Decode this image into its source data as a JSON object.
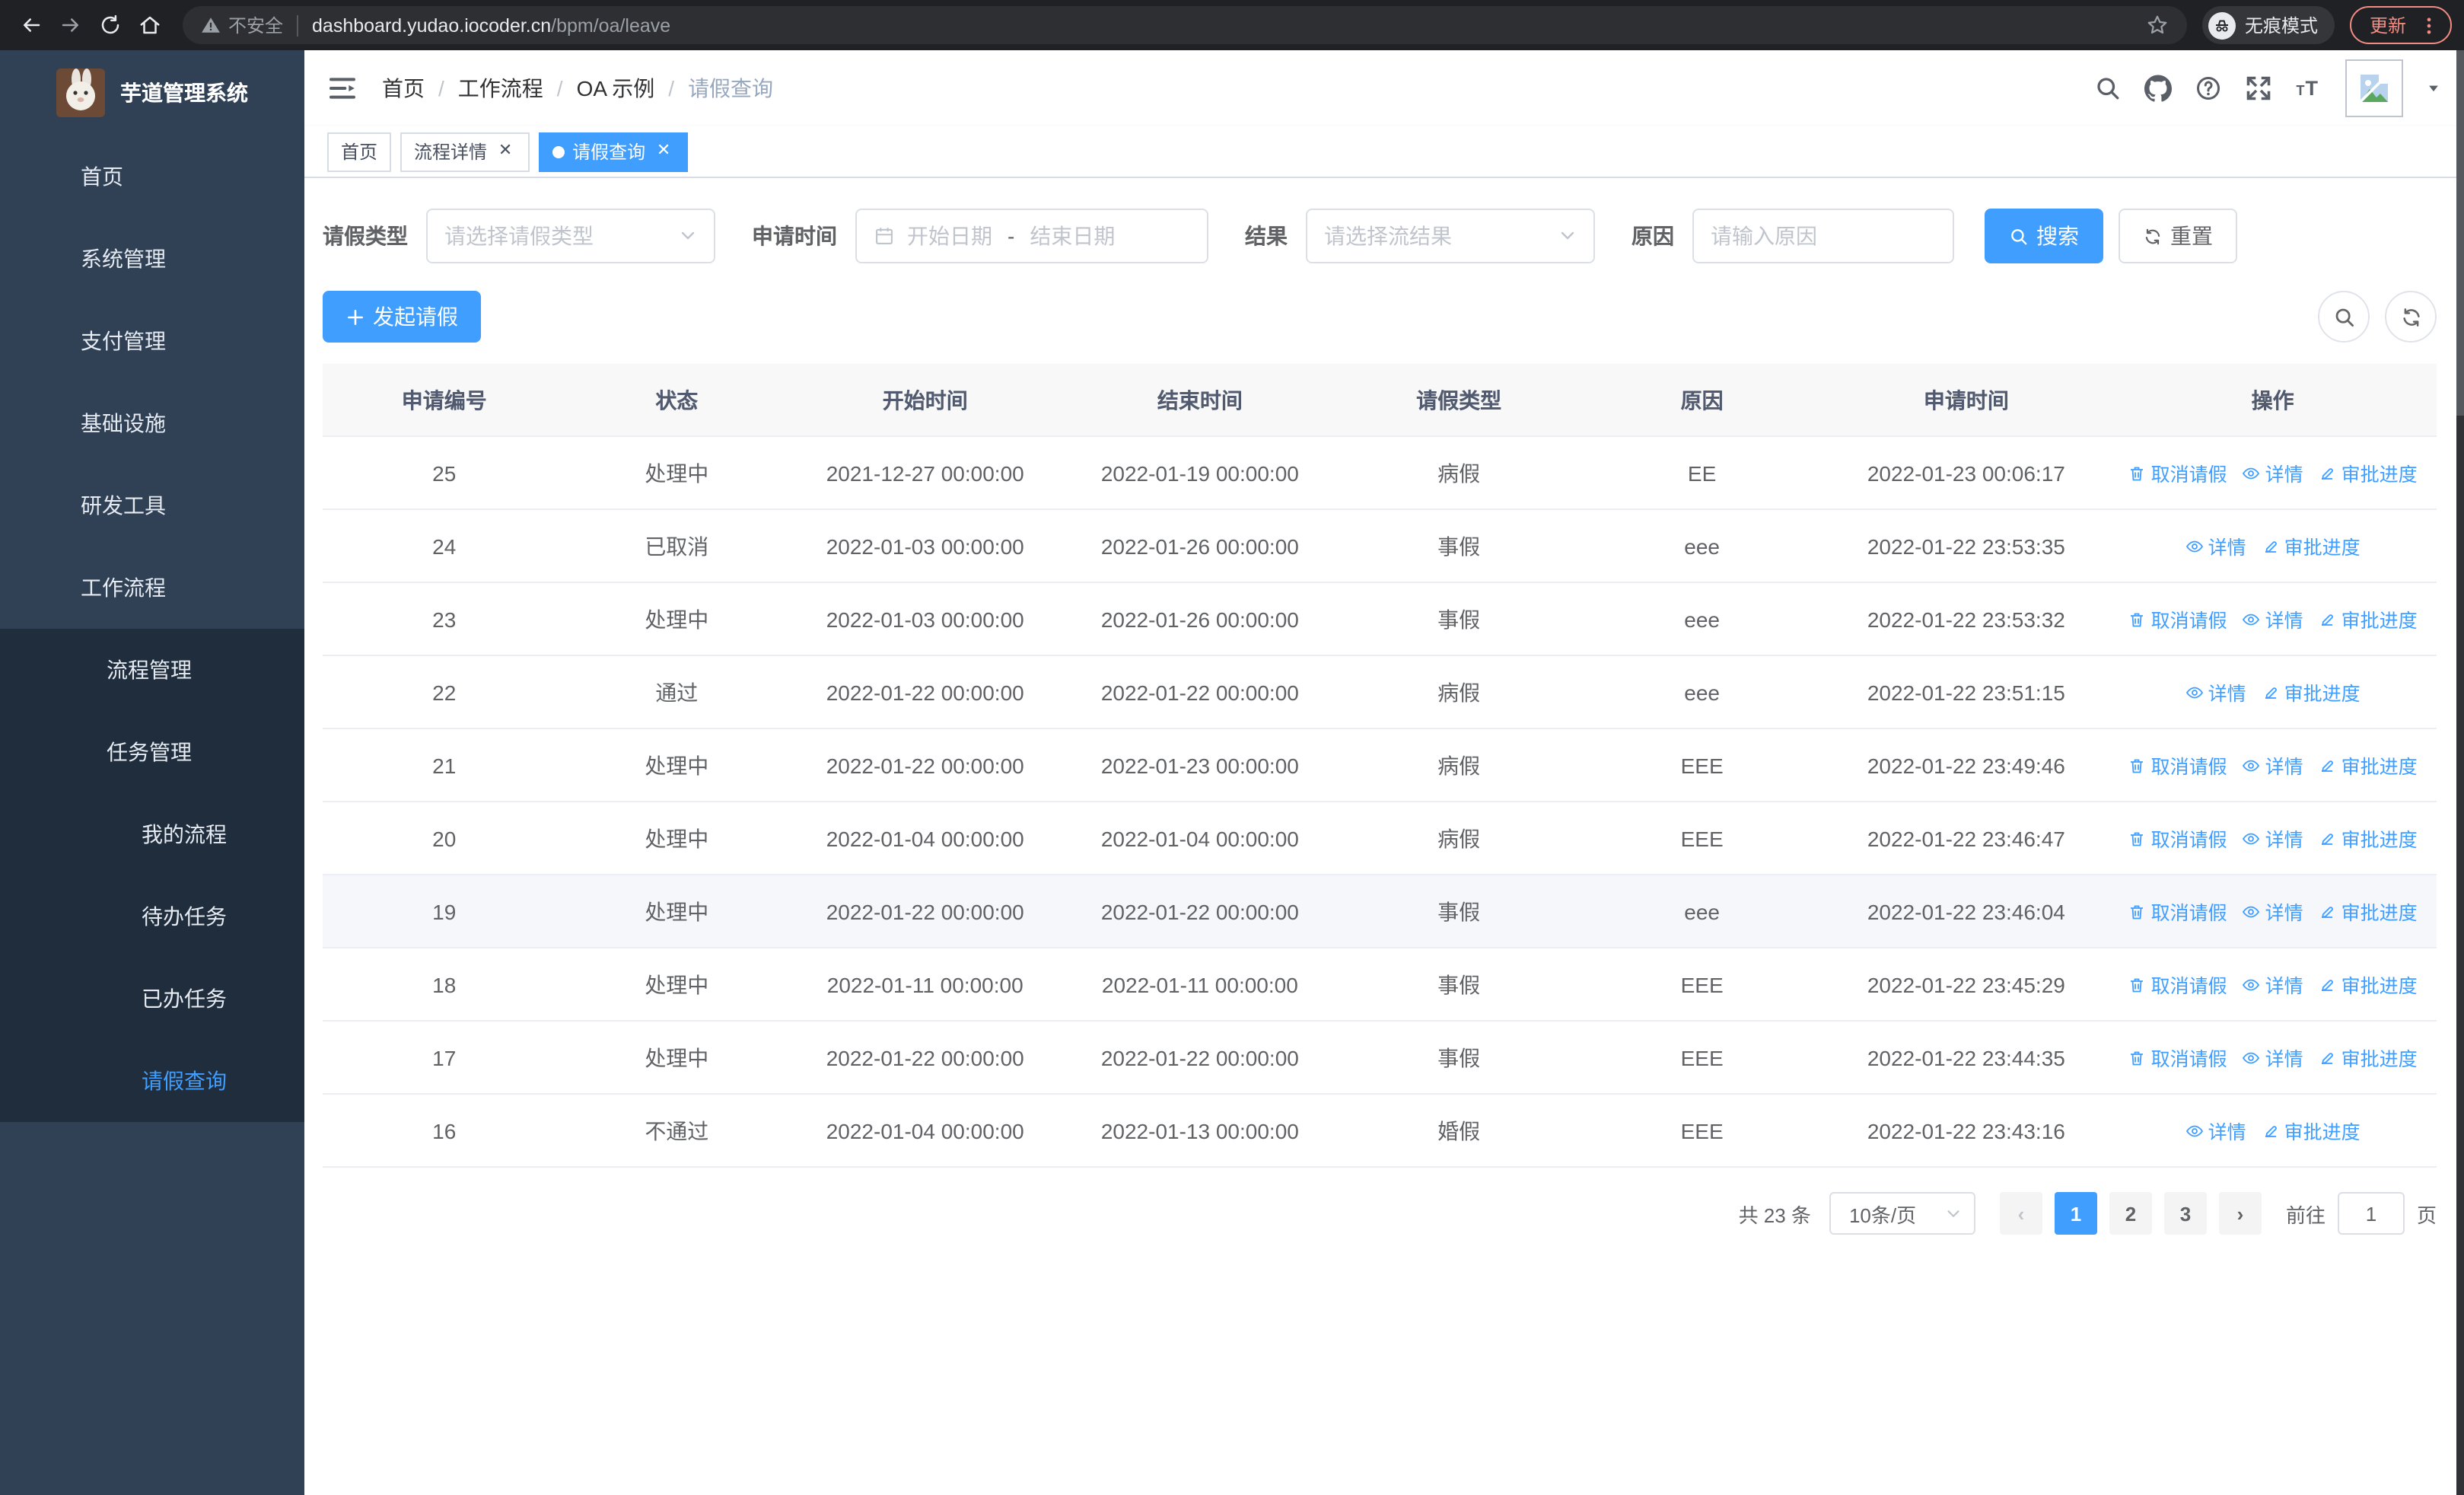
{
  "colors": {
    "accent": "#409EFF",
    "sidebar_bg": "#304156",
    "submenu_bg": "#1f2d3d",
    "update_chip": "#f28b82"
  },
  "browser": {
    "security_label": "不安全",
    "url_host": "dashboard.yudao.iocoder.cn",
    "url_path": "/bpm/oa/leave",
    "incognito_label": "无痕模式",
    "update_label": "更新"
  },
  "sidebar": {
    "logo_title": "芋道管理系统",
    "items": [
      {
        "label": "首页",
        "icon": "dashboard-icon",
        "depth": 1,
        "chevron": "",
        "submenu": false,
        "active": false
      },
      {
        "label": "系统管理",
        "icon": "gear-icon",
        "depth": 1,
        "chevron": "down",
        "submenu": false,
        "active": false
      },
      {
        "label": "支付管理",
        "icon": "yen-icon",
        "depth": 1,
        "chevron": "down",
        "submenu": false,
        "active": false
      },
      {
        "label": "基础设施",
        "icon": "monitor-icon",
        "depth": 1,
        "chevron": "down",
        "submenu": false,
        "active": false
      },
      {
        "label": "研发工具",
        "icon": "toolbox-icon",
        "depth": 1,
        "chevron": "down",
        "submenu": false,
        "active": false
      },
      {
        "label": "工作流程",
        "icon": "briefcase-icon",
        "depth": 1,
        "chevron": "up",
        "submenu": false,
        "active": false
      },
      {
        "label": "流程管理",
        "icon": "list-icon",
        "depth": 2,
        "chevron": "down",
        "submenu": true,
        "active": false
      },
      {
        "label": "任务管理",
        "icon": "flow-icon",
        "depth": 2,
        "chevron": "up",
        "submenu": true,
        "active": false
      },
      {
        "label": "我的流程",
        "icon": "robot-icon",
        "depth": 3,
        "chevron": "",
        "submenu": true,
        "active": false
      },
      {
        "label": "待办任务",
        "icon": "eye-icon",
        "depth": 3,
        "chevron": "",
        "submenu": true,
        "active": false
      },
      {
        "label": "已办任务",
        "icon": "eye-closed-icon",
        "depth": 3,
        "chevron": "",
        "submenu": true,
        "active": false
      },
      {
        "label": "请假查询",
        "icon": "user-icon",
        "depth": 3,
        "chevron": "",
        "submenu": true,
        "active": true
      }
    ]
  },
  "header": {
    "breadcrumb": [
      {
        "label": "首页",
        "current": false
      },
      {
        "label": "工作流程",
        "current": false
      },
      {
        "label": "OA 示例",
        "current": false
      },
      {
        "label": "请假查询",
        "current": true
      }
    ]
  },
  "tags": [
    {
      "label": "首页",
      "closable": false,
      "active": false
    },
    {
      "label": "流程详情",
      "closable": true,
      "active": false
    },
    {
      "label": "请假查询",
      "closable": true,
      "active": true
    }
  ],
  "filters": {
    "leave_type_label": "请假类型",
    "leave_type_placeholder": "请选择请假类型",
    "apply_time_label": "申请时间",
    "start_placeholder": "开始日期",
    "range_separator": "-",
    "end_placeholder": "结束日期",
    "result_label": "结果",
    "result_placeholder": "请选择流结果",
    "reason_label": "原因",
    "reason_placeholder": "请输入原因",
    "search_label": "搜索",
    "reset_label": "重置"
  },
  "toolbar": {
    "create_label": "发起请假"
  },
  "actions": {
    "cancel": {
      "label": "取消请假",
      "icon": "trash-icon"
    },
    "detail": {
      "label": "详情",
      "icon": "view-icon"
    },
    "progress": {
      "label": "审批进度",
      "icon": "edit-icon"
    }
  },
  "table": {
    "columns": [
      "申请编号",
      "状态",
      "开始时间",
      "结束时间",
      "请假类型",
      "原因",
      "申请时间",
      "操作"
    ],
    "rows": [
      {
        "id": "25",
        "status": "处理中",
        "start": "2021-12-27 00:00:00",
        "end": "2022-01-19 00:00:00",
        "type": "病假",
        "reason": "EE",
        "applied": "2022-01-23 00:06:17",
        "actions": [
          "cancel",
          "detail",
          "progress"
        ],
        "hover": false
      },
      {
        "id": "24",
        "status": "已取消",
        "start": "2022-01-03 00:00:00",
        "end": "2022-01-26 00:00:00",
        "type": "事假",
        "reason": "eee",
        "applied": "2022-01-22 23:53:35",
        "actions": [
          "detail",
          "progress"
        ],
        "hover": false
      },
      {
        "id": "23",
        "status": "处理中",
        "start": "2022-01-03 00:00:00",
        "end": "2022-01-26 00:00:00",
        "type": "事假",
        "reason": "eee",
        "applied": "2022-01-22 23:53:32",
        "actions": [
          "cancel",
          "detail",
          "progress"
        ],
        "hover": false
      },
      {
        "id": "22",
        "status": "通过",
        "start": "2022-01-22 00:00:00",
        "end": "2022-01-22 00:00:00",
        "type": "病假",
        "reason": "eee",
        "applied": "2022-01-22 23:51:15",
        "actions": [
          "detail",
          "progress"
        ],
        "hover": false
      },
      {
        "id": "21",
        "status": "处理中",
        "start": "2022-01-22 00:00:00",
        "end": "2022-01-23 00:00:00",
        "type": "病假",
        "reason": "EEE",
        "applied": "2022-01-22 23:49:46",
        "actions": [
          "cancel",
          "detail",
          "progress"
        ],
        "hover": false
      },
      {
        "id": "20",
        "status": "处理中",
        "start": "2022-01-04 00:00:00",
        "end": "2022-01-04 00:00:00",
        "type": "病假",
        "reason": "EEE",
        "applied": "2022-01-22 23:46:47",
        "actions": [
          "cancel",
          "detail",
          "progress"
        ],
        "hover": false
      },
      {
        "id": "19",
        "status": "处理中",
        "start": "2022-01-22 00:00:00",
        "end": "2022-01-22 00:00:00",
        "type": "事假",
        "reason": "eee",
        "applied": "2022-01-22 23:46:04",
        "actions": [
          "cancel",
          "detail",
          "progress"
        ],
        "hover": true
      },
      {
        "id": "18",
        "status": "处理中",
        "start": "2022-01-11 00:00:00",
        "end": "2022-01-11 00:00:00",
        "type": "事假",
        "reason": "EEE",
        "applied": "2022-01-22 23:45:29",
        "actions": [
          "cancel",
          "detail",
          "progress"
        ],
        "hover": false
      },
      {
        "id": "17",
        "status": "处理中",
        "start": "2022-01-22 00:00:00",
        "end": "2022-01-22 00:00:00",
        "type": "事假",
        "reason": "EEE",
        "applied": "2022-01-22 23:44:35",
        "actions": [
          "cancel",
          "detail",
          "progress"
        ],
        "hover": false
      },
      {
        "id": "16",
        "status": "不通过",
        "start": "2022-01-04 00:00:00",
        "end": "2022-01-13 00:00:00",
        "type": "婚假",
        "reason": "EEE",
        "applied": "2022-01-22 23:43:16",
        "actions": [
          "detail",
          "progress"
        ],
        "hover": false
      }
    ]
  },
  "pagination": {
    "total_label": "共 23 条",
    "page_size_label": "10条/页",
    "pages": [
      "1",
      "2",
      "3"
    ],
    "current": "1",
    "jump_prefix": "前往",
    "jump_value": "1",
    "jump_suffix": "页"
  }
}
